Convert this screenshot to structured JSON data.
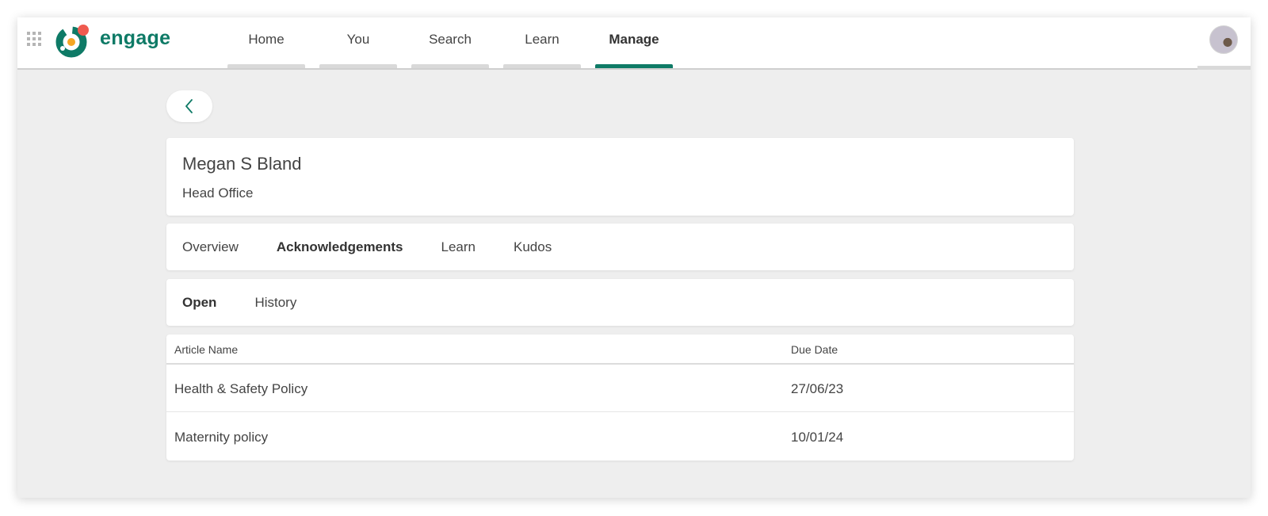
{
  "app": {
    "brand": "engage"
  },
  "nav": {
    "items": [
      {
        "label": "Home",
        "active": false
      },
      {
        "label": "You",
        "active": false
      },
      {
        "label": "Search",
        "active": false
      },
      {
        "label": "Learn",
        "active": false
      },
      {
        "label": "Manage",
        "active": true
      }
    ]
  },
  "colors": {
    "accent": "#0e7a66",
    "logo_dot": "#ef5a4f",
    "logo_inner": "#f5a623"
  },
  "profile": {
    "name": "Megan S Bland",
    "location": "Head Office"
  },
  "tabs": [
    "Overview",
    "Acknowledgements",
    "Learn",
    "Kudos"
  ],
  "tabs_active": "Acknowledgements",
  "subtabs": [
    "Open",
    "History"
  ],
  "subtabs_active": "Open",
  "table": {
    "columns": [
      "Article Name",
      "Due Date"
    ],
    "rows": [
      {
        "article": "Health & Safety Policy",
        "due": "27/06/23"
      },
      {
        "article": "Maternity policy",
        "due": "10/01/24"
      }
    ]
  }
}
